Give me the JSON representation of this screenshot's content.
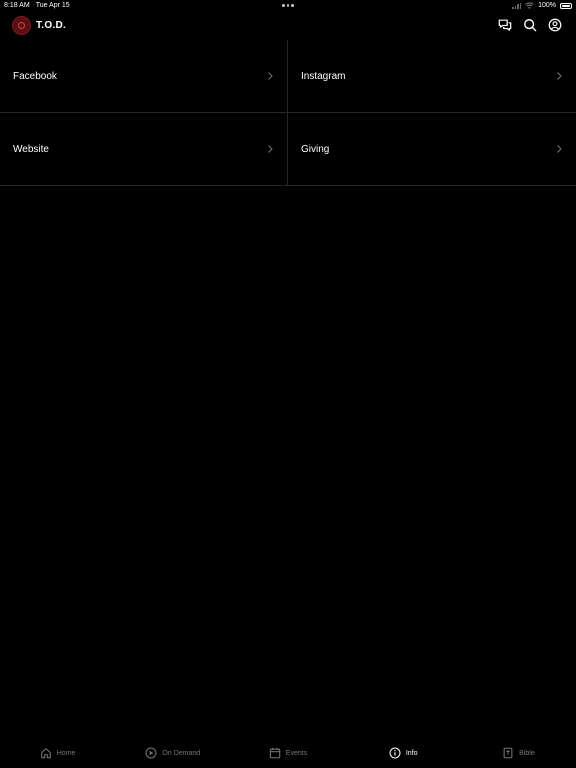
{
  "status_bar": {
    "time": "8:18 AM",
    "date": "Tue Apr 15",
    "battery": "100%"
  },
  "header": {
    "title": "T.O.D.",
    "actions": [
      {
        "icon": "chat-icon"
      },
      {
        "icon": "search-icon"
      },
      {
        "icon": "account-icon"
      }
    ]
  },
  "links": [
    {
      "label": "Facebook"
    },
    {
      "label": "Instagram"
    },
    {
      "label": "Website"
    },
    {
      "label": "Giving"
    }
  ],
  "tabs": [
    {
      "label": "Home",
      "icon": "home-icon",
      "active": false
    },
    {
      "label": "On Demand",
      "icon": "play-circle-icon",
      "active": false
    },
    {
      "label": "Events",
      "icon": "calendar-icon",
      "active": false
    },
    {
      "label": "Info",
      "icon": "info-icon",
      "active": true
    },
    {
      "label": "Bible",
      "icon": "bible-icon",
      "active": false
    }
  ],
  "colors": {
    "background": "#000000",
    "text": "#ffffff",
    "inactive_tab": "#777777",
    "divider": "#262626",
    "logo": "#5a0f14"
  }
}
